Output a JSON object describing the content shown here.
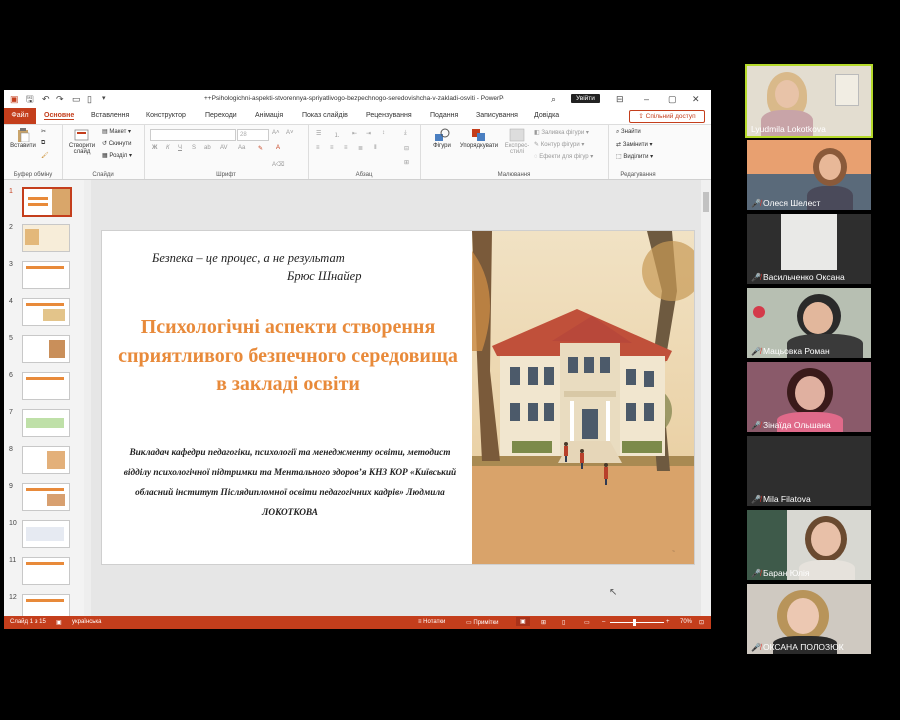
{
  "window": {
    "doc_title": "++Psihologichni-aspekti-stvorennya-spriyatlivogo-bezpechnogo-seredovishcha-v-zakladi-osviti - PowerPoint",
    "sign_in": "Увійти"
  },
  "ribbon_tabs": [
    "Файл",
    "Основне",
    "Вставлення",
    "Конструктор",
    "Переходи",
    "Анімація",
    "Показ слайдів",
    "Рецензування",
    "Подання",
    "Записування",
    "Довідка"
  ],
  "share_label": "Спільний доступ",
  "ribbon": {
    "paste": "Вставити",
    "new_slide": "Створити слайд",
    "layout": "Макет",
    "reset": "Скинути",
    "section": "Розділ",
    "shapes": "Фігури",
    "arrange": "Упорядкувати",
    "quick_styles": "Експрес-стилі",
    "shape_fill": "Заливка фігури",
    "shape_outline": "Контур фігури",
    "shape_effects": "Ефекти для фігур",
    "find": "Знайти",
    "replace": "Замінити",
    "select": "Виділити",
    "font_size": "28",
    "groups": {
      "clipboard": "Буфер обміну",
      "slides": "Слайди",
      "font": "Шрифт",
      "paragraph": "Абзац",
      "drawing": "Малювання",
      "editing": "Редагування"
    }
  },
  "thumb_numbers": [
    "1",
    "2",
    "3",
    "4",
    "5",
    "6",
    "7",
    "8",
    "9",
    "10",
    "11",
    "12"
  ],
  "slide": {
    "quote_line1": "Безпека – це процес, а не результат",
    "quote_line2": "Брюс Шнайер",
    "title": "Психологічні аспекти створення сприятливого безпечного середовища в закладі освіти",
    "author": "Викладач кафедри педагогіки, психології та менеджменту освіти, методист відділу психологічної підтримки та Ментального здоров’я КНЗ КОР «Київський обласний інститут Післядипломної освіти педагогічних кадрів» Людмила ЛОКОТКОВА"
  },
  "status": {
    "slide_count": "Слайд 1 з 15",
    "language": "українська",
    "notes": "Нотатки",
    "comments": "Примітки",
    "zoom": "70%"
  },
  "participants": [
    "Lyudmila Lokotkova",
    "Олеся Шелест",
    "Васильченко Оксана",
    "Мацьовка Роман",
    "Зінаїда Ольшана",
    "Mila Filatova",
    "Баран Юлія",
    "ОКСАНА ПОЛОЗЮК"
  ],
  "colors": {
    "accent": "#c43e1c",
    "title": "#e88a3a",
    "speaker_border": "#b5d92a"
  }
}
